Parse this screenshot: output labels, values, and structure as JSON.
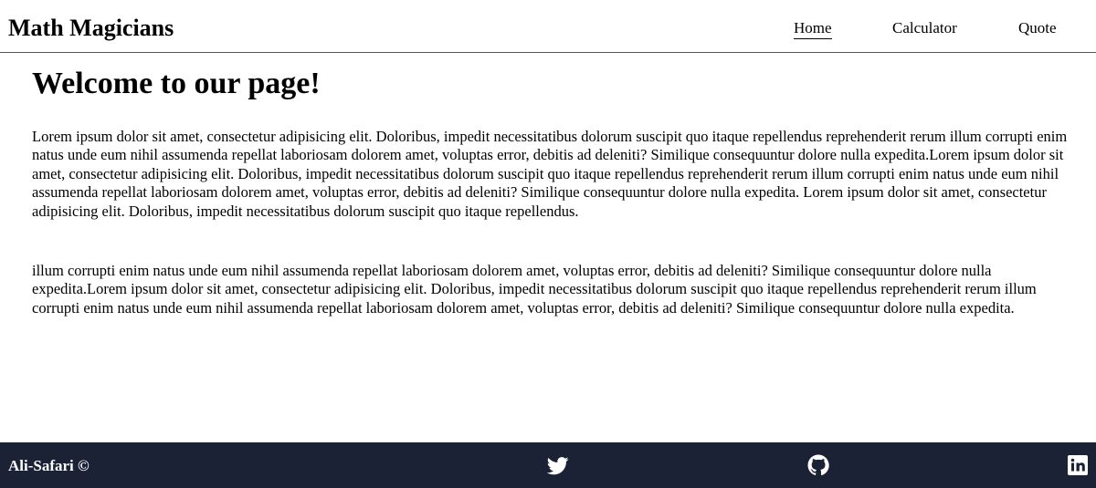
{
  "header": {
    "brand": "Math Magicians",
    "nav": [
      {
        "label": "Home",
        "active": true
      },
      {
        "label": "Calculator",
        "active": false
      },
      {
        "label": "Quote",
        "active": false
      }
    ]
  },
  "main": {
    "title": "Welcome to our page!",
    "paragraphs": [
      "Lorem ipsum dolor sit amet, consectetur adipisicing elit. Doloribus, impedit necessitatibus dolorum suscipit quo itaque repellendus reprehenderit rerum illum corrupti enim natus unde eum nihil assumenda repellat laboriosam dolorem amet, voluptas error, debitis ad deleniti? Similique consequuntur dolore nulla expedita.Lorem ipsum dolor sit amet, consectetur adipisicing elit. Doloribus, impedit necessitatibus dolorum suscipit quo itaque repellendus reprehenderit rerum illum corrupti enim natus unde eum nihil assumenda repellat laboriosam dolorem amet, voluptas error, debitis ad deleniti? Similique consequuntur dolore nulla expedita. Lorem ipsum dolor sit amet, consectetur adipisicing elit. Doloribus, impedit necessitatibus dolorum suscipit quo itaque repellendus.",
      "illum corrupti enim natus unde eum nihil assumenda repellat laboriosam dolorem amet, voluptas error, debitis ad deleniti? Similique consequuntur dolore nulla expedita.Lorem ipsum dolor sit amet, consectetur adipisicing elit. Doloribus, impedit necessitatibus dolorum suscipit quo itaque repellendus reprehenderit rerum illum corrupti enim natus unde eum nihil assumenda repellat laboriosam dolorem amet, voluptas error, debitis ad deleniti? Similique consequuntur dolore nulla expedita."
    ]
  },
  "footer": {
    "author": "Ali-Safari  ©",
    "background_color": "#1b2236",
    "icons": [
      "twitter-icon",
      "github-icon",
      "linkedin-icon"
    ]
  }
}
